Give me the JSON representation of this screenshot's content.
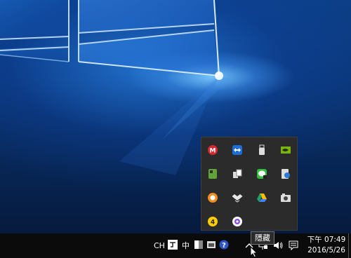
{
  "taskbar": {
    "input_language": "CH",
    "ime_mode": "中",
    "tooltip": "隱藏",
    "clock": {
      "time": "下午 07:49",
      "date": "2016/5/26"
    }
  },
  "tray_icons": [
    "mega-icon",
    "teamviewer-icon",
    "usb-drive-icon",
    "nvidia-icon",
    "evernote-icon",
    "copy-icon",
    "line-icon",
    "device-icon",
    "avast-icon",
    "dropbox-icon",
    "google-drive-icon",
    "camera-icon",
    "norton-icon",
    "picasa-icon"
  ],
  "colors": {
    "taskbar_bg": "#0b0b0b",
    "popup_bg": "#2b2b2b"
  }
}
